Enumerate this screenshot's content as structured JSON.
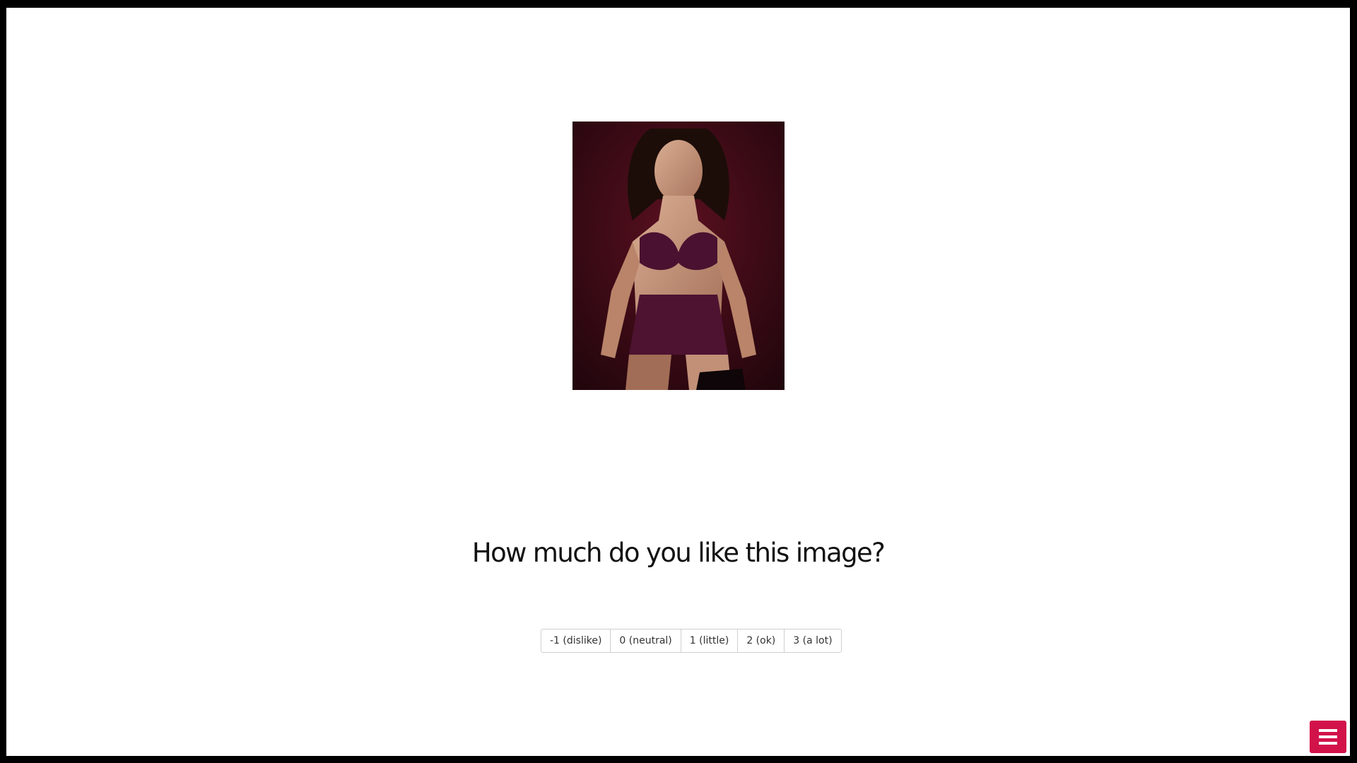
{
  "question": "How much do you like this image?",
  "rating_options": [
    {
      "label": "-1 (dislike)"
    },
    {
      "label": "0 (neutral)"
    },
    {
      "label": "1 (little)"
    },
    {
      "label": "2 (ok)"
    },
    {
      "label": "3 (a lot)"
    }
  ],
  "menu_button": {
    "icon": "hamburger-menu-icon",
    "color": "#d2134a"
  },
  "image": {
    "subject": "photo",
    "dominant_colors": [
      "#2a0a10",
      "#5a1530",
      "#c99a82"
    ]
  }
}
